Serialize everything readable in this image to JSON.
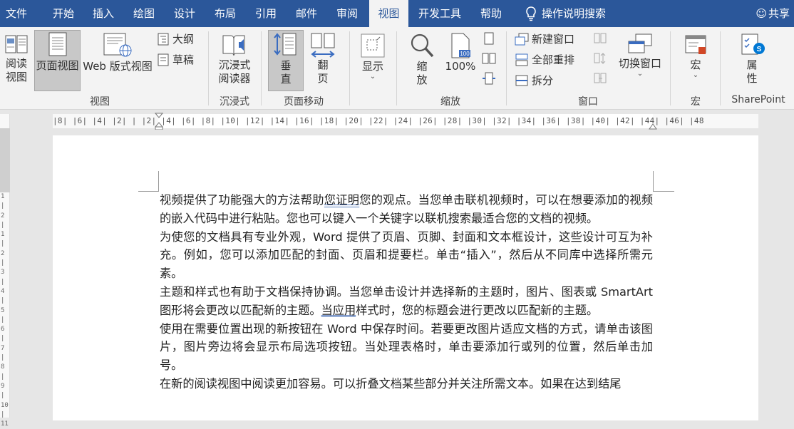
{
  "tabs": [
    {
      "label": "文件"
    },
    {
      "label": "开始"
    },
    {
      "label": "插入"
    },
    {
      "label": "绘图"
    },
    {
      "label": "设计"
    },
    {
      "label": "布局"
    },
    {
      "label": "引用"
    },
    {
      "label": "邮件"
    },
    {
      "label": "审阅"
    },
    {
      "label": "视图",
      "active": true
    },
    {
      "label": "开发工具"
    },
    {
      "label": "帮助"
    }
  ],
  "tell_me": "操作说明搜索",
  "share": "共享",
  "ribbon": {
    "views": {
      "read_mode": "阅读\n视图",
      "read_mode_l1": "阅读",
      "read_mode_l2": "视图",
      "print_layout": "页面视图",
      "web_layout": "Web 版式视图",
      "outline": "大纲",
      "draft": "草稿",
      "group_label": "视图"
    },
    "immersive": {
      "reader_l1": "沉浸式",
      "reader_l2": "阅读器",
      "group_label": "沉浸式"
    },
    "page_movement": {
      "vertical_l1": "垂",
      "vertical_l2": "直",
      "side_l1": "翻",
      "side_l2": "页",
      "group_label": "页面移动"
    },
    "show": {
      "label": "显示"
    },
    "zoom": {
      "zoom_l1": "缩",
      "zoom_l2": "放",
      "hundred": "100%",
      "group_label": "缩放"
    },
    "window": {
      "new_window": "新建窗口",
      "arrange_all": "全部重排",
      "split": "拆分",
      "switch_windows": "切换窗口",
      "group_label": "窗口"
    },
    "macros": {
      "label": "宏",
      "group_label": "宏"
    },
    "sharepoint": {
      "l1": "属",
      "l2": "性",
      "group_label": "SharePoint"
    }
  },
  "ruler": {
    "numbers": "|8|  |6|  |4|  |2|     |  |2|  |4|  |6|  |8|  |10|  |12|  |14|  |16|  |18|  |20|  |22|  |24|  |26|  |28|  |30|  |32|  |34|  |36|  |38|  |40|  |42|  |44|  |46|  |48"
  },
  "document": {
    "p1_a": "视频提供了功能强大的方法帮助",
    "p1_u": "您证明",
    "p1_b": "您的观点。当您单击联机视频时，可以在想要添加的视频的嵌入代码中进行粘贴。您也可以键入一个关键字以联机搜索最适合您的文档的视频。",
    "p2": "为使您的文档具有专业外观，Word 提供了页眉、页脚、封面和文本框设计，这些设计可互为补充。例如，您可以添加匹配的封面、页眉和提要栏。单击“插入”，然后从不同库中选择所需元素。",
    "p3_a": "主题和样式也有助于文档保持协调。当您单击设计并选择新的主题时，图片、图表或 SmartArt 图形将会更改以匹配新的主题。",
    "p3_u": "当应用",
    "p3_b": "样式时，您的标题会进行更改以匹配新的主题。",
    "p4": "使用在需要位置出现的新按钮在 Word 中保存时间。若要更改图片适应文档的方式，请单击该图片，图片旁边将会显示布局选项按钮。当处理表格时，单击要添加行或列的位置，然后单击加号。",
    "p5": "在新的阅读视图中阅读更加容易。可以折叠文档某些部分并关注所需文本。如果在达到结尾"
  },
  "colors": {
    "tabbar": "#2b579a",
    "ribbon_bg": "#f3f3f3",
    "selected": "#c8c8c8",
    "link_underline": "#5b7fbf"
  }
}
